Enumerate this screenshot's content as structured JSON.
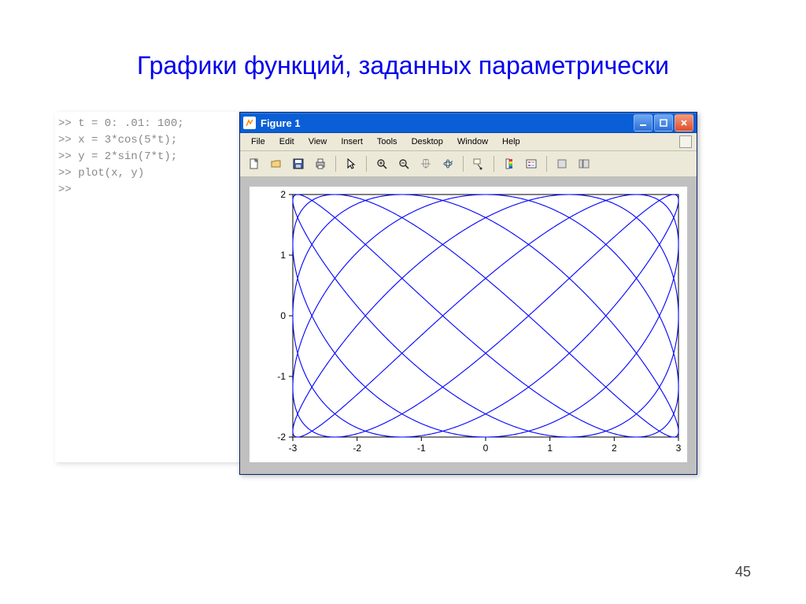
{
  "slide": {
    "title": "Графики функций, заданных параметрически",
    "page_number": "45"
  },
  "code": {
    "line1": ">> t = 0: .01: 100;",
    "line2": ">> x = 3*cos(5*t);",
    "line3": ">> y = 2*sin(7*t);",
    "line4": ">> plot(x, y)",
    "line5": ">>"
  },
  "window": {
    "title": "Figure 1",
    "menus": [
      "File",
      "Edit",
      "View",
      "Insert",
      "Tools",
      "Desktop",
      "Window",
      "Help"
    ],
    "toolbar_icons": [
      "new-file-icon",
      "open-file-icon",
      "save-icon",
      "print-icon",
      "pointer-icon",
      "zoom-in-icon",
      "zoom-out-icon",
      "pan-icon",
      "rotate3d-icon",
      "data-cursor-icon",
      "insert-colorbar-icon",
      "insert-legend-icon",
      "hide-plot-tools-icon",
      "show-plot-tools-icon"
    ]
  },
  "chart_data": {
    "type": "line",
    "parametric": {
      "x_formula": "3*cos(5*t)",
      "y_formula": "2*sin(7*t)",
      "t_start": 0,
      "t_step": 0.01,
      "t_end": 100
    },
    "xlim": [
      -3,
      3
    ],
    "ylim": [
      -2,
      2
    ],
    "xticks": [
      -3,
      -2,
      -1,
      0,
      1,
      2,
      3
    ],
    "yticks": [
      -2,
      -1,
      0,
      1,
      2
    ],
    "line_color": "#0000ff",
    "title": "",
    "xlabel": "",
    "ylabel": ""
  }
}
